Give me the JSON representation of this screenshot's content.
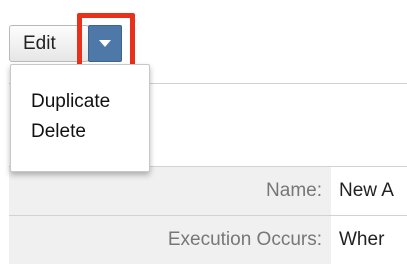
{
  "toolbar": {
    "edit_label": "Edit",
    "dropdown_icon": "caret-down-icon",
    "highlight_color": "#e8301a",
    "accent_color": "#4d78a8"
  },
  "menu": {
    "items": [
      {
        "label": "Duplicate"
      },
      {
        "label": "Delete"
      }
    ]
  },
  "details": {
    "rows": [
      {
        "label": "Name:",
        "value": "New A"
      },
      {
        "label": "Execution Occurs:",
        "value": "Wher"
      }
    ]
  }
}
